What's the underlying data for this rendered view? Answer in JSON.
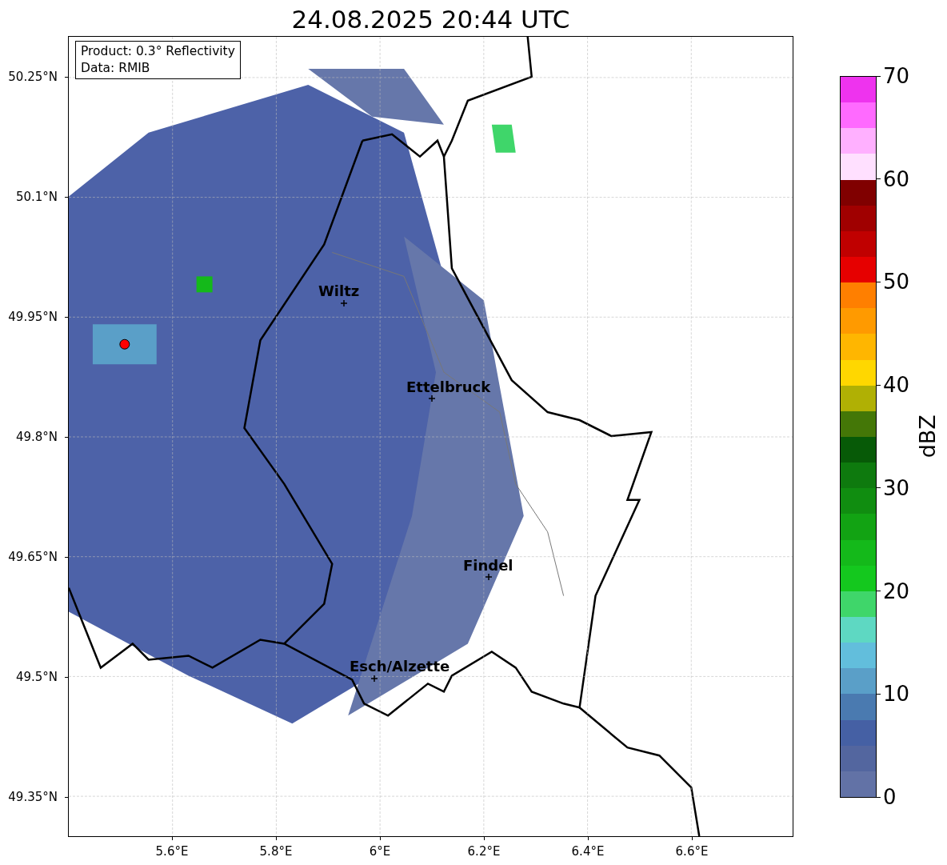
{
  "title": "24.08.2025 20:44 UTC",
  "info_box": [
    "Product: 0.3° Reflectivity",
    "Data: RMIB"
  ],
  "map": {
    "y_ticks": [
      "50.25°N",
      "50.1°N",
      "49.95°N",
      "49.8°N",
      "49.65°N",
      "49.5°N",
      "49.35°N"
    ],
    "x_ticks": [
      "5.6°E",
      "5.8°E",
      "6°E",
      "6.2°E",
      "6.4°E",
      "6.6°E"
    ],
    "cities": [
      {
        "name": "Wiltz"
      },
      {
        "name": "Ettelbruck"
      },
      {
        "name": "Findel"
      },
      {
        "name": "Esch/Alzette"
      }
    ]
  },
  "colorbar": {
    "label": "dBZ",
    "ticks": [
      "70",
      "60",
      "50",
      "40",
      "30",
      "20",
      "10",
      "0"
    ],
    "bands": [
      {
        "color": "#6272a6"
      },
      {
        "color": "#53669f"
      },
      {
        "color": "#4560a4"
      },
      {
        "color": "#4a7ab0"
      },
      {
        "color": "#5a9fc8"
      },
      {
        "color": "#62bedc"
      },
      {
        "color": "#5ed8c2"
      },
      {
        "color": "#3fd66a"
      },
      {
        "color": "#14c81e"
      },
      {
        "color": "#14b91a"
      },
      {
        "color": "#12a313"
      },
      {
        "color": "#108d10"
      },
      {
        "color": "#0e7a0e"
      },
      {
        "color": "#075a07"
      },
      {
        "color": "#447707"
      },
      {
        "color": "#b0b004"
      },
      {
        "color": "#ffd700"
      },
      {
        "color": "#ffb600"
      },
      {
        "color": "#ff9a00"
      },
      {
        "color": "#ff7f00"
      },
      {
        "color": "#e60000"
      },
      {
        "color": "#c00000"
      },
      {
        "color": "#a00000"
      },
      {
        "color": "#800000"
      },
      {
        "color": "#ffe0ff"
      },
      {
        "color": "#ffb0ff"
      },
      {
        "color": "#ff6aff"
      },
      {
        "color": "#ee33ee"
      }
    ]
  }
}
